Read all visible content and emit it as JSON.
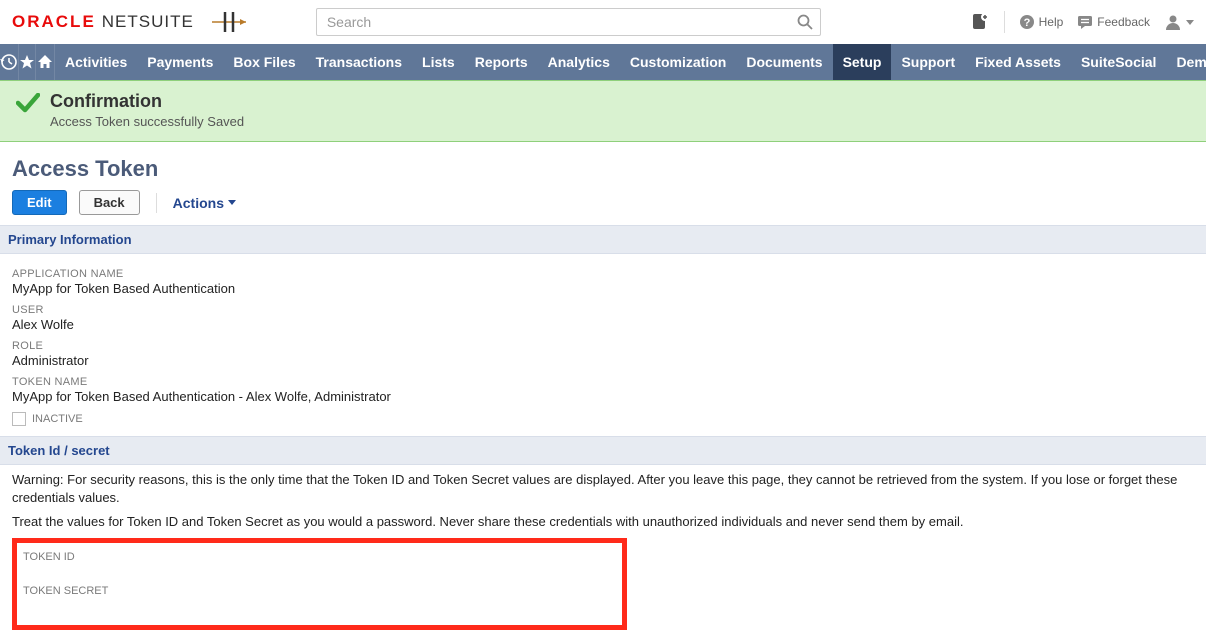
{
  "brand": {
    "oracle": "ORACLE",
    "netsuite": "NETSUITE"
  },
  "search": {
    "placeholder": "Search"
  },
  "topright": {
    "help": "Help",
    "feedback": "Feedback"
  },
  "nav": {
    "items": [
      "Activities",
      "Payments",
      "Box Files",
      "Transactions",
      "Lists",
      "Reports",
      "Analytics",
      "Customization",
      "Documents",
      "Setup",
      "Support",
      "Fixed Assets",
      "SuiteSocial",
      "Demo F"
    ],
    "active_index": 9
  },
  "confirmation": {
    "title": "Confirmation",
    "message": "Access Token successfully Saved"
  },
  "page": {
    "title": "Access Token"
  },
  "buttons": {
    "edit": "Edit",
    "back": "Back",
    "actions": "Actions"
  },
  "sections": {
    "primary_label": "Primary Information",
    "token_label": "Token Id / secret"
  },
  "fields": {
    "app_name_label": "APPLICATION NAME",
    "app_name_value": "MyApp for Token Based Authentication",
    "user_label": "USER",
    "user_value": "Alex Wolfe",
    "role_label": "ROLE",
    "role_value": "Administrator",
    "token_name_label": "TOKEN NAME",
    "token_name_value": "MyApp for Token Based Authentication - Alex Wolfe, Administrator",
    "inactive_label": "INACTIVE"
  },
  "warning": {
    "line1": "Warning: For security reasons, this is the only time that the Token ID and Token Secret values are displayed. After you leave this page, they cannot be retrieved from the system. If you lose or forget these credentials values.",
    "line2": "Treat the values for Token ID and Token Secret as you would a password. Never share these credentials with unauthorized individuals and never send them by email."
  },
  "token_box": {
    "id_label": "TOKEN ID",
    "secret_label": "TOKEN SECRET"
  }
}
